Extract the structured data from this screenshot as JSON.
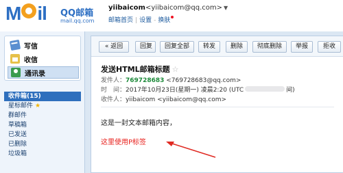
{
  "header": {
    "logo_text": "Mail",
    "logo_brand": "QQ邮箱",
    "logo_domain": "mail.qq.com",
    "user_name": "yiibaicom",
    "user_email": "<yiibaicom@qq.com>",
    "caret": "▼",
    "links": [
      "邮箱首页",
      "设置",
      "换肤"
    ]
  },
  "sidebar": {
    "compose": [
      {
        "label": "写信",
        "icon": "pencil-icon"
      },
      {
        "label": "收信",
        "icon": "inbox-icon"
      },
      {
        "label": "通讯录",
        "icon": "contacts-icon"
      }
    ],
    "folders": [
      {
        "label": "收件箱(15)",
        "active": true
      },
      {
        "label": "星标邮件",
        "starred": true
      },
      {
        "label": "群邮件"
      },
      {
        "label": "草稿箱"
      },
      {
        "label": "已发送"
      },
      {
        "label": "已删除"
      },
      {
        "label": "垃圾箱"
      }
    ]
  },
  "toolbar": {
    "back": "« 返回",
    "reply": "回复",
    "reply_all": "回复全部",
    "forward": "转发",
    "delete": "删除",
    "delete_permanently": "彻底删除",
    "report": "举报",
    "reject": "拒收"
  },
  "message": {
    "subject": "发送HTML邮箱标题",
    "star": "☆",
    "sender_label": "发件人：",
    "sender_name": "769728683",
    "sender_email": "<769728683@qq.com>",
    "time_label": "时　间：",
    "time_value": "2017年10月23日(星期一) 凌晨2:20 (UTC",
    "time_suffix": "间)",
    "recipient_label": "收件人：",
    "recipient_value": "yiibaicom <yiibaicom@qq.com>",
    "body_text": "这是一封文本邮箱内容，",
    "body_p_tag": "这里使用P标签"
  },
  "colors": {
    "accent": "#2e6fbd",
    "red_text": "#e8201c",
    "sender_green": "#1d8a3a"
  }
}
